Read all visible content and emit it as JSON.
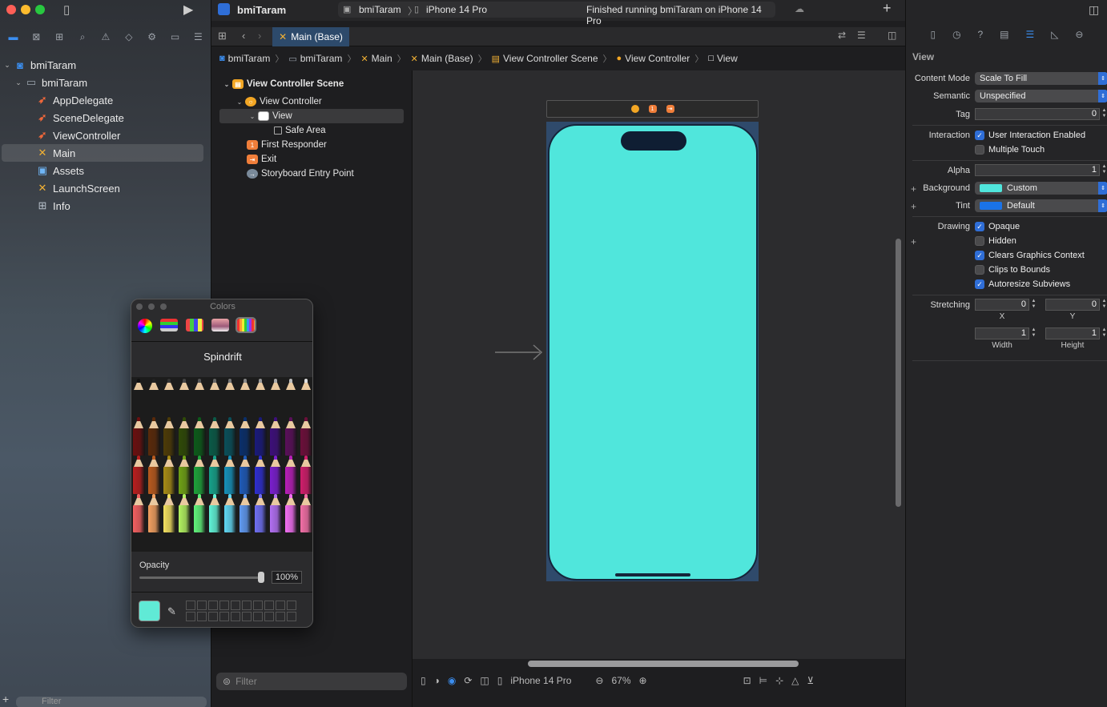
{
  "window": {
    "project": "bmiTaram",
    "scheme": "bmiTaram",
    "device": "iPhone 14 Pro",
    "status": "Finished running bmiTaram on iPhone 14 Pro"
  },
  "navigator": {
    "items": [
      {
        "label": "bmiTaram",
        "icon": "project-icon"
      },
      {
        "label": "bmiTaram",
        "icon": "folder-icon"
      },
      {
        "label": "AppDelegate",
        "icon": "swift-file-icon"
      },
      {
        "label": "SceneDelegate",
        "icon": "swift-file-icon"
      },
      {
        "label": "ViewController",
        "icon": "swift-file-icon"
      },
      {
        "label": "Main",
        "icon": "storyboard-icon"
      },
      {
        "label": "Assets",
        "icon": "asset-catalog-icon"
      },
      {
        "label": "LaunchScreen",
        "icon": "storyboard-icon"
      },
      {
        "label": "Info",
        "icon": "plist-icon"
      }
    ],
    "filter_placeholder": "Filter"
  },
  "editor": {
    "active_tab": "Main (Base)",
    "breadcrumbs": [
      "bmiTaram",
      "bmiTaram",
      "Main",
      "Main (Base)",
      "View Controller Scene",
      "View Controller",
      "View"
    ]
  },
  "outline": {
    "items": [
      {
        "label": "View Controller Scene"
      },
      {
        "label": "View Controller"
      },
      {
        "label": "View"
      },
      {
        "label": "Safe Area"
      },
      {
        "label": "First Responder"
      },
      {
        "label": "Exit"
      },
      {
        "label": "Storyboard Entry Point"
      }
    ],
    "filter_placeholder": "Filter"
  },
  "canvas": {
    "device": "iPhone 14 Pro",
    "zoom": "67%",
    "view_background": "#50E6DC"
  },
  "inspector": {
    "title": "View",
    "content_mode_label": "Content Mode",
    "content_mode": "Scale To Fill",
    "semantic_label": "Semantic",
    "semantic": "Unspecified",
    "tag_label": "Tag",
    "tag": "0",
    "interaction_label": "Interaction",
    "user_interaction": "User Interaction Enabled",
    "multiple_touch": "Multiple Touch",
    "alpha_label": "Alpha",
    "alpha": "1",
    "background_label": "Background",
    "background": "Custom",
    "tint_label": "Tint",
    "tint": "Default",
    "drawing_label": "Drawing",
    "opaque": "Opaque",
    "hidden": "Hidden",
    "clears_graphics": "Clears Graphics Context",
    "clips_to_bounds": "Clips to Bounds",
    "autoresize": "Autoresize Subviews",
    "stretching_label": "Stretching",
    "stretch_x": "0",
    "stretch_y": "0",
    "stretch_w": "1",
    "stretch_h": "1",
    "x_label": "X",
    "y_label": "Y",
    "width_label": "Width",
    "height_label": "Height"
  },
  "colors_panel": {
    "title": "Colors",
    "crayon_name": "Spindrift",
    "opacity_label": "Opacity",
    "opacity": "100%",
    "selected_color": "#60EAD6"
  }
}
